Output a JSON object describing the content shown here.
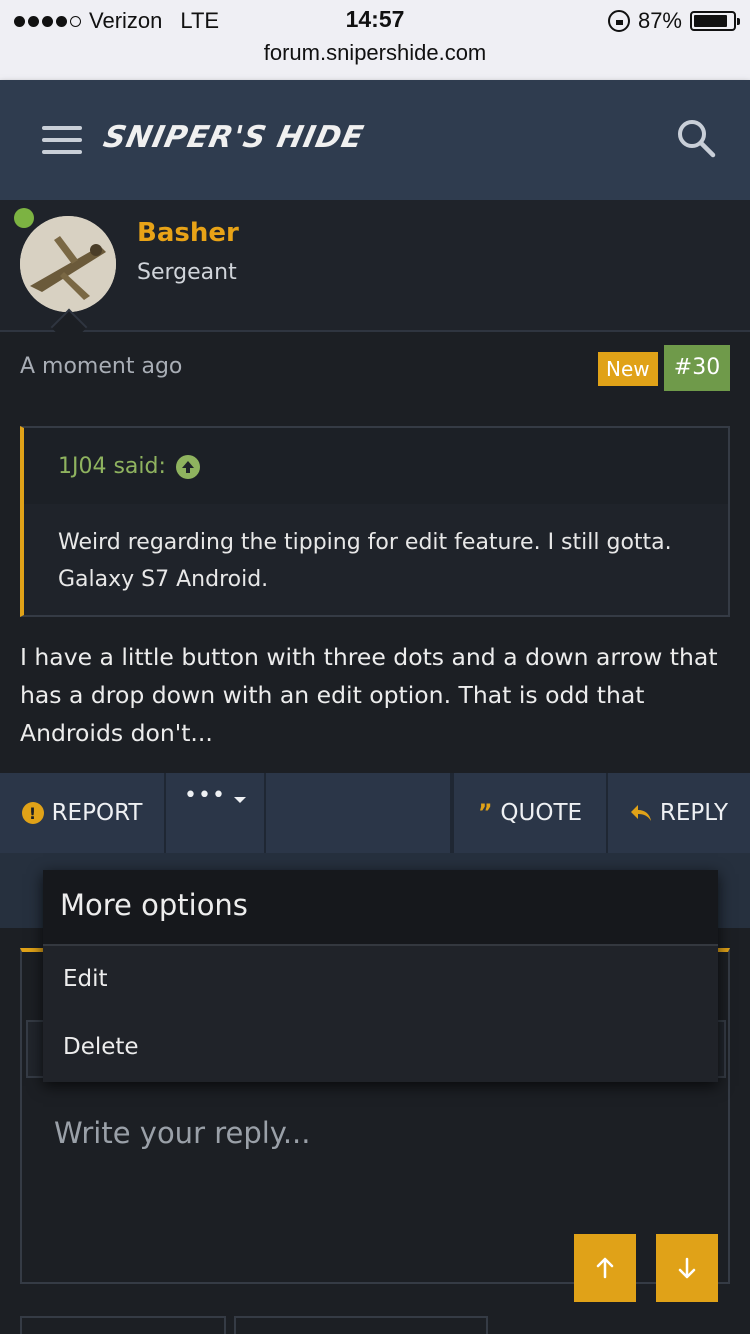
{
  "status_bar": {
    "carrier": "Verizon",
    "network": "LTE",
    "time": "14:57",
    "battery": "87%",
    "battery_level": 0.87,
    "url": "forum.snipershide.com"
  },
  "header": {
    "logo": "SNIPER'S HIDE"
  },
  "post": {
    "username": "Basher",
    "user_title": "Sergeant",
    "time": "A moment ago",
    "badge_new": "New",
    "post_number": "#30",
    "quote_author": "1J04 said:",
    "quote_text": "Weird regarding the tipping for edit feature. I still gotta. Galaxy S7 Android.",
    "body": "I have a little button with three dots and a down arrow that has a drop down with an edit option. That is odd that Androids don't..."
  },
  "actions": {
    "report": "REPORT",
    "more": "•••",
    "quote": "QUOTE",
    "reply": "REPLY"
  },
  "menu": {
    "title": "More options",
    "items": [
      "Edit",
      "Delete"
    ]
  },
  "reply_box": {
    "placeholder": "Write your reply..."
  },
  "colors": {
    "accent": "#e0a218",
    "header_bg": "#2f3c4f",
    "page_bg": "#1c1f24",
    "green": "#6f9a4a"
  }
}
